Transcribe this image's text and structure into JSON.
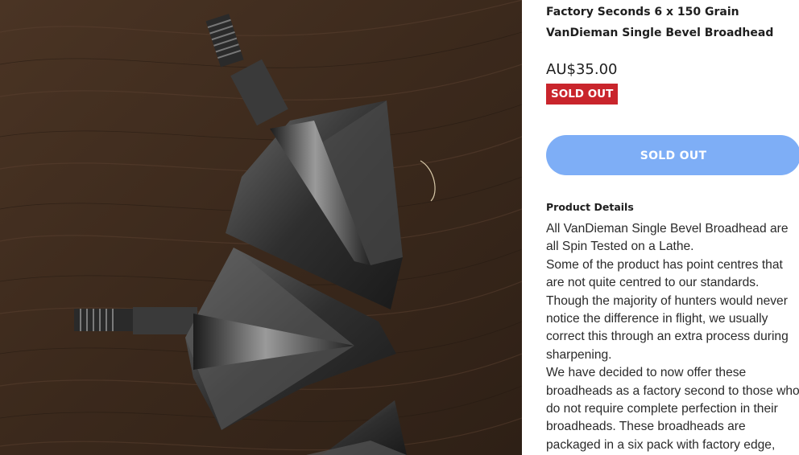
{
  "product": {
    "title": "Factory Seconds 6 x 150 Grain VanDieman Single Bevel Broadhead",
    "price": "AU$35.00",
    "badge": "SOLD OUT",
    "button_label": "SOLD OUT",
    "details_heading": "Product Details",
    "description": [
      "All VanDieman Single Bevel Broadhead are all Spin Tested on a Lathe.",
      "Some of the product has point centres that are not quite centred to our standards. Though the majority of hunters would never notice the difference in flight, we usually correct this through an extra process during sharpening.",
      "We have decided to now offer these broadheads as a factory second to those who do not require complete perfection in their broadheads. These broadheads are packaged in a six pack with factory edge,"
    ]
  },
  "colors": {
    "badge_bg": "#c9252c",
    "button_bg": "#7eaef6"
  }
}
